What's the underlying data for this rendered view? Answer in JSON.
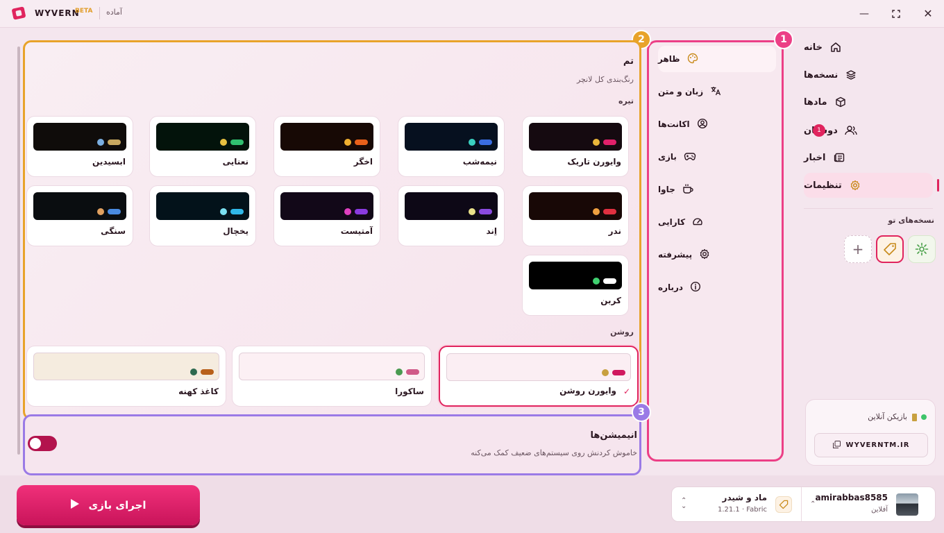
{
  "titlebar": {
    "brand": "WYVERN",
    "beta": "BETA",
    "status": "آماده"
  },
  "nav": {
    "items": [
      {
        "label": "خانه",
        "icon": "home-icon"
      },
      {
        "label": "نسخه‌ها",
        "icon": "layers-icon"
      },
      {
        "label": "مادها",
        "icon": "box-icon"
      },
      {
        "label": "دوستان",
        "icon": "users-icon",
        "badge": "1"
      },
      {
        "label": "اخبار",
        "icon": "news-icon"
      },
      {
        "label": "تنظیمات",
        "icon": "gear-icon",
        "active": true
      }
    ],
    "instances_title": "نسخه‌های تو"
  },
  "server": {
    "label": "بازیکن آنلاین",
    "address": "WYVERNTM.IR"
  },
  "submenu": {
    "items": [
      {
        "label": "ظاهر",
        "icon": "palette-icon"
      },
      {
        "label": "زبان و متن",
        "icon": "translate-icon"
      },
      {
        "label": "اکانت‌ها",
        "icon": "account-icon"
      },
      {
        "label": "بازی",
        "icon": "gamepad-icon"
      },
      {
        "label": "جاوا",
        "icon": "coffee-icon"
      },
      {
        "label": "کارایی",
        "icon": "speed-icon"
      },
      {
        "label": "پیشرفته",
        "icon": "settings-icon"
      },
      {
        "label": "درباره",
        "icon": "info-icon"
      }
    ]
  },
  "markers": [
    "1",
    "2",
    "3"
  ],
  "theme": {
    "title": "تم",
    "subtitle": "رنگ‌بندی کل لانچر",
    "dark_label": "تیره",
    "light_label": "روشن",
    "dark": [
      {
        "name": "وایورن تاریک",
        "bg": "#150a10",
        "dot": "#e8b53a",
        "pill": "#e0206a"
      },
      {
        "name": "نیمه‌شب",
        "bg": "#06101f",
        "dot": "#3ad0c0",
        "pill": "#3a6de0"
      },
      {
        "name": "اخگر",
        "bg": "#170905",
        "dot": "#f0b030",
        "pill": "#e8601a"
      },
      {
        "name": "نعنایی",
        "bg": "#03130b",
        "dot": "#e8c040",
        "pill": "#30c070"
      },
      {
        "name": "ابسیدین",
        "bg": "#0f0c0a",
        "dot": "#7aaee0",
        "pill": "#c8a860"
      },
      {
        "name": "ندر",
        "bg": "#180806",
        "dot": "#f0a040",
        "pill": "#e03040"
      },
      {
        "name": "اِند",
        "bg": "#0d0816",
        "dot": "#e8e08a",
        "pill": "#8a4ae0"
      },
      {
        "name": "آمتیست",
        "bg": "#120818",
        "dot": "#e040c0",
        "pill": "#8a3ae0"
      },
      {
        "name": "یخچال",
        "bg": "#03121a",
        "dot": "#7ae0f0",
        "pill": "#30b8e8"
      },
      {
        "name": "سنگی",
        "bg": "#0a0d10",
        "dot": "#e0a060",
        "pill": "#4a8ae0"
      },
      {
        "name": "کربن",
        "bg": "#000000",
        "dot": "#40d070",
        "pill": "#ffffff"
      }
    ],
    "light": [
      {
        "name": "وایورن روشن",
        "bg": "#fbeef3",
        "dot": "#c8a040",
        "pill": "#d0185e",
        "selected": true
      },
      {
        "name": "ساکورا",
        "bg": "#fcf0f4",
        "dot": "#4a9a50",
        "pill": "#d05a88"
      },
      {
        "name": "کاغذ کهنه",
        "bg": "#f5ecdf",
        "dot": "#2e6a50",
        "pill": "#b8601a"
      }
    ]
  },
  "animations": {
    "title": "انیمیشن‌ها",
    "subtitle": "خاموش کردنش روی سیستم‌های ضعیف کمک می‌کنه",
    "enabled": false
  },
  "play": {
    "label": "اجرای بازی"
  },
  "bottom": {
    "user": "amirabbas8585",
    "user_status": "آفلاین",
    "modpack": "ماد و شیدر",
    "version": "1.21.1 · Fabric"
  }
}
